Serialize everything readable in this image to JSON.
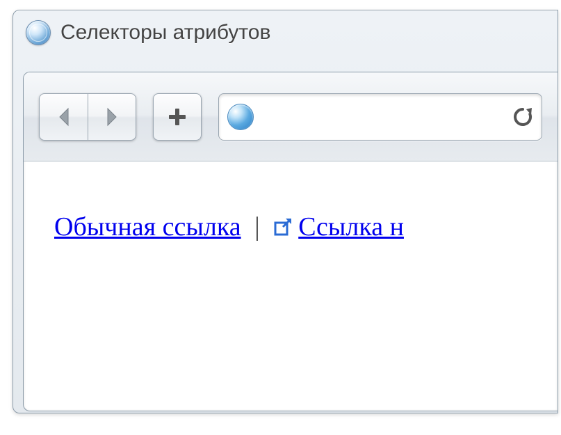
{
  "window": {
    "title": "Селекторы атрибутов"
  },
  "toolbar": {
    "back_label": "Back",
    "forward_label": "Forward",
    "newtab_label": "New Tab",
    "reload_label": "Reload",
    "address_value": ""
  },
  "content": {
    "link1": "Обычная ссылка",
    "separator": "|",
    "link2": "Ссылка н"
  }
}
